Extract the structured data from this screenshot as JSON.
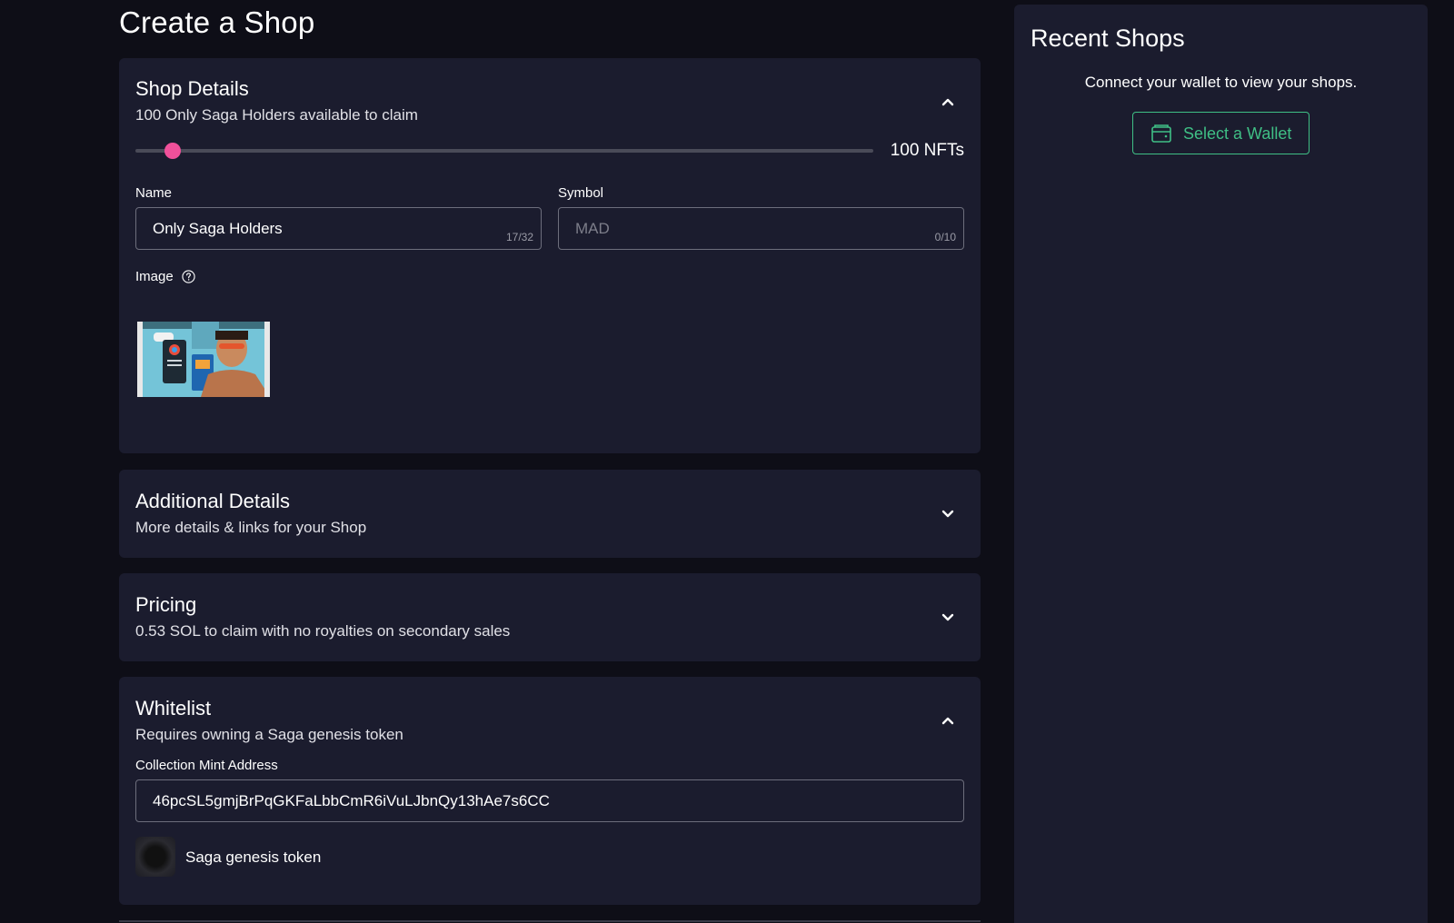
{
  "page": {
    "title": "Create a Shop"
  },
  "shop_details": {
    "title": "Shop Details",
    "subtitle": "100 Only Saga Holders available to claim",
    "slider_value_label": "100 NFTs",
    "slider_fraction": 0.04,
    "name_label": "Name",
    "name_value": "Only Saga Holders",
    "name_counter": "17/32",
    "symbol_label": "Symbol",
    "symbol_placeholder": "MAD",
    "symbol_counter": "0/10",
    "image_label": "Image",
    "expanded": true
  },
  "additional_details": {
    "title": "Additional Details",
    "subtitle": "More details & links for your Shop",
    "expanded": false
  },
  "pricing": {
    "title": "Pricing",
    "subtitle": "0.53 SOL to claim with no royalties on secondary sales",
    "expanded": false
  },
  "whitelist": {
    "title": "Whitelist",
    "subtitle": "Requires owning a Saga genesis token",
    "mint_label": "Collection Mint Address",
    "mint_value": "46pcSL5gmjBrPqGKFaLbbCmR6iVuLJbnQy13hAe7s6CC",
    "token_name": "Saga genesis token",
    "expanded": true
  },
  "recent_shops": {
    "title": "Recent Shops",
    "message": "Connect your wallet to view your shops.",
    "button_label": "Select a Wallet"
  },
  "colors": {
    "background": "#0e0e17",
    "card": "#1b1c2e",
    "accent_pink": "#f0509a",
    "accent_green": "#3fbf85"
  }
}
